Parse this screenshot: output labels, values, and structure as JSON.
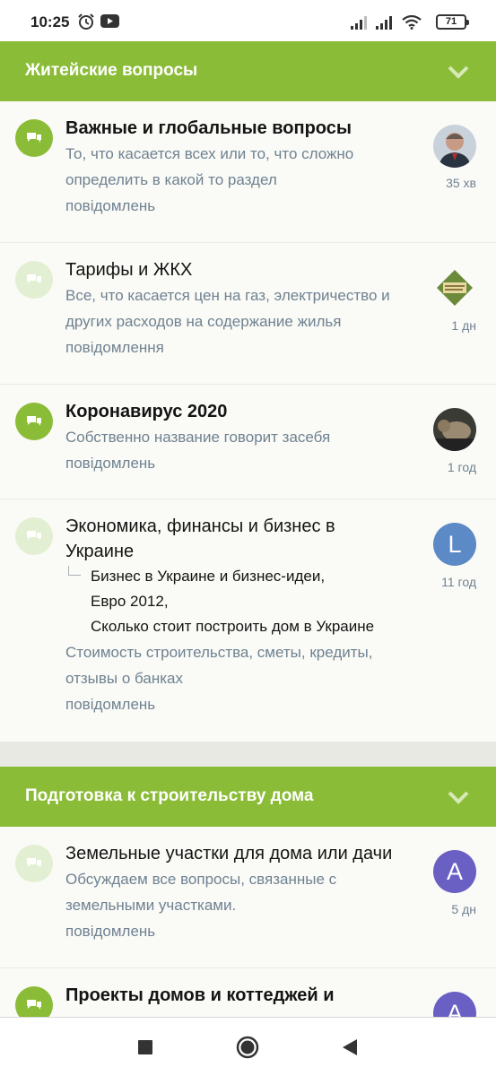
{
  "status_bar": {
    "time": "10:25",
    "battery": "71",
    "alarm_icon": "alarm-clock-icon",
    "youtube_icon": "youtube-icon"
  },
  "categories": [
    {
      "title": "Житейские вопросы",
      "nodes": [
        {
          "title": "Важные и глобальные вопросы",
          "description": "То, что касается всех или то, что сложно определить в какой то раздел",
          "stat": "повідомлень",
          "time": "35 хв",
          "unread": true
        },
        {
          "title": "Тарифы и ЖКХ",
          "description": "Все, что касается цен на газ, электричество и других расходов на содержание жилья",
          "stat": "повідомлення",
          "time": "1 дн",
          "unread": false
        },
        {
          "title": "Коронавирус 2020",
          "description": "Собственно название говорит засебя",
          "stat": "повідомлень",
          "time": "1 год",
          "unread": true
        },
        {
          "title": "Экономика, финансы и бизнес в Украине",
          "subforums": [
            "Бизнес в Украине и бизнес-идеи,",
            "Евро 2012,",
            "Сколько стоит построить дом в Украине"
          ],
          "description": "Стоимость строительства, сметы, кредиты, отзывы о банках",
          "stat": "повідомлень",
          "time": "11 год",
          "avatar_letter": "L",
          "unread": false
        }
      ]
    },
    {
      "title": "Подготовка к строительству дома",
      "nodes": [
        {
          "title": "Земельные участки для дома или дачи",
          "description": "Обсуждаем все вопросы, связанные с земельными участками.",
          "stat": "повідомлень",
          "time": "5 дн",
          "avatar_letter": "A",
          "unread": false
        },
        {
          "title": "Проекты домов и коттеджей и",
          "avatar_letter": "A",
          "unread": true
        }
      ]
    }
  ],
  "colors": {
    "header_green": "#8bbc37",
    "read_icon": "#e3efd2",
    "meta_text": "#6f8291",
    "avatar_blue": "#5b8ac6",
    "avatar_purple": "#6a5fc2"
  },
  "nav": {
    "back_icon": "back-triangle-icon",
    "home_icon": "home-circle-icon",
    "recents_icon": "recents-square-icon"
  }
}
